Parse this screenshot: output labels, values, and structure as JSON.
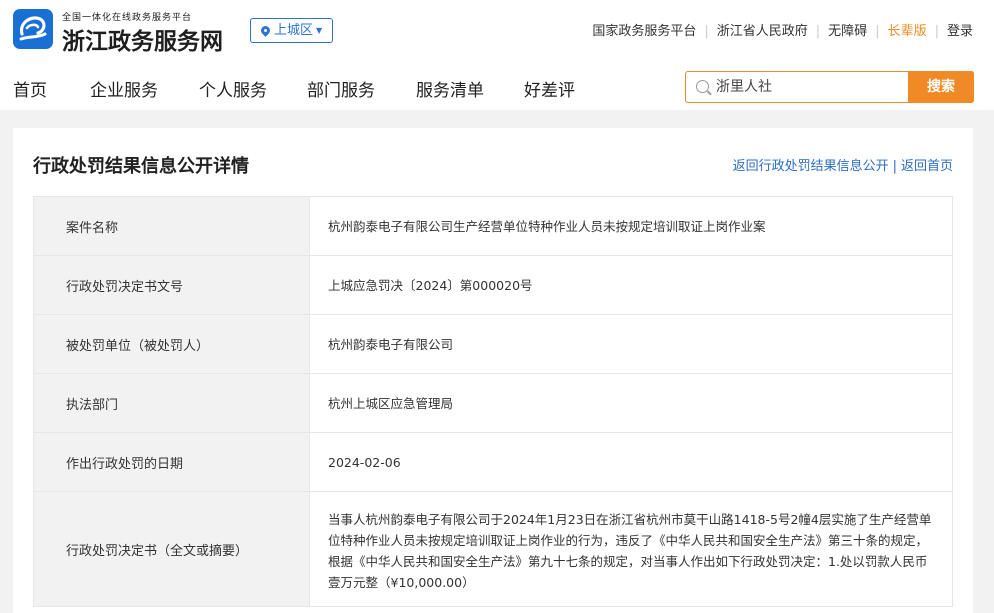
{
  "header": {
    "logo_small": "全国一体化在线政务服务平台",
    "logo_big": "浙江政务服务网",
    "region": "上城区",
    "top_links": [
      "国家政务服务平台",
      "浙江省人民政府",
      "无障碍",
      "长辈版",
      "登录"
    ]
  },
  "nav": [
    "首页",
    "企业服务",
    "个人服务",
    "部门服务",
    "服务清单",
    "好差评"
  ],
  "search": {
    "placeholder": "浙里人社",
    "button": "搜索"
  },
  "detail": {
    "title": "行政处罚结果信息公开详情",
    "back_links": [
      "返回行政处罚结果信息公开",
      "返回首页"
    ],
    "rows": [
      {
        "key": "案件名称",
        "value": "杭州韵泰电子有限公司生产经营单位特种作业人员未按规定培训取证上岗作业案"
      },
      {
        "key": "行政处罚决定书文号",
        "value": "上城应急罚决〔2024〕第000020号"
      },
      {
        "key": "被处罚单位（被处罚人）",
        "value": "杭州韵泰电子有限公司"
      },
      {
        "key": "执法部门",
        "value": "杭州上城区应急管理局"
      },
      {
        "key": "作出行政处罚的日期",
        "value": "2024-02-06"
      },
      {
        "key": "行政处罚决定书（全文或摘要）",
        "value": "当事人杭州韵泰电子有限公司于2024年1月23日在浙江省杭州市莫干山路1418-5号2幢4层实施了生产经营单位特种作业人员未按规定培训取证上岗作业的行为，违反了《中华人民共和国安全生产法》第三十条的规定，根据《中华人民共和国安全生产法》第九十七条的规定，对当事人作出如下行政处罚决定：1.处以罚款人民币壹万元整（¥10,000.00）"
      }
    ]
  },
  "colors": {
    "primary": "#2b73d6",
    "accent": "#f08a24",
    "link": "#2b6cc4"
  }
}
